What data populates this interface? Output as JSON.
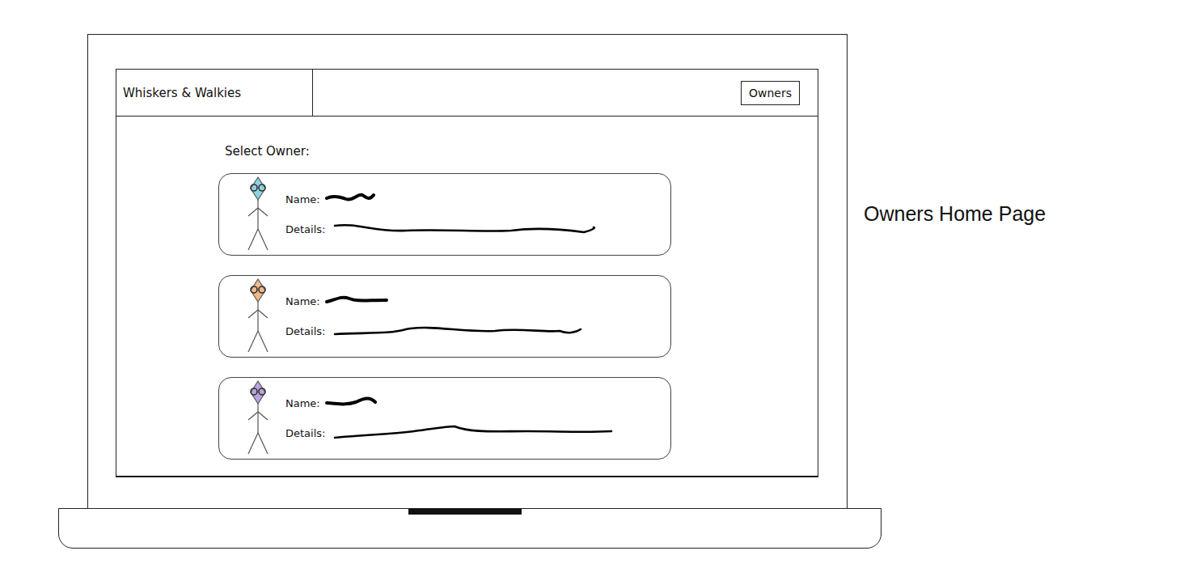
{
  "app": {
    "logo": "Whiskers & Walkies",
    "nav_button": "Owners"
  },
  "page": {
    "heading": "Select Owner:"
  },
  "owners": [
    {
      "name_label": "Name:",
      "details_label": "Details:",
      "color": "#8fd3e0"
    },
    {
      "name_label": "Name:",
      "details_label": "Details:",
      "color": "#f0b98a"
    },
    {
      "name_label": "Name:",
      "details_label": "Details:",
      "color": "#b9a3e0"
    }
  ],
  "caption": "Owners Home Page"
}
